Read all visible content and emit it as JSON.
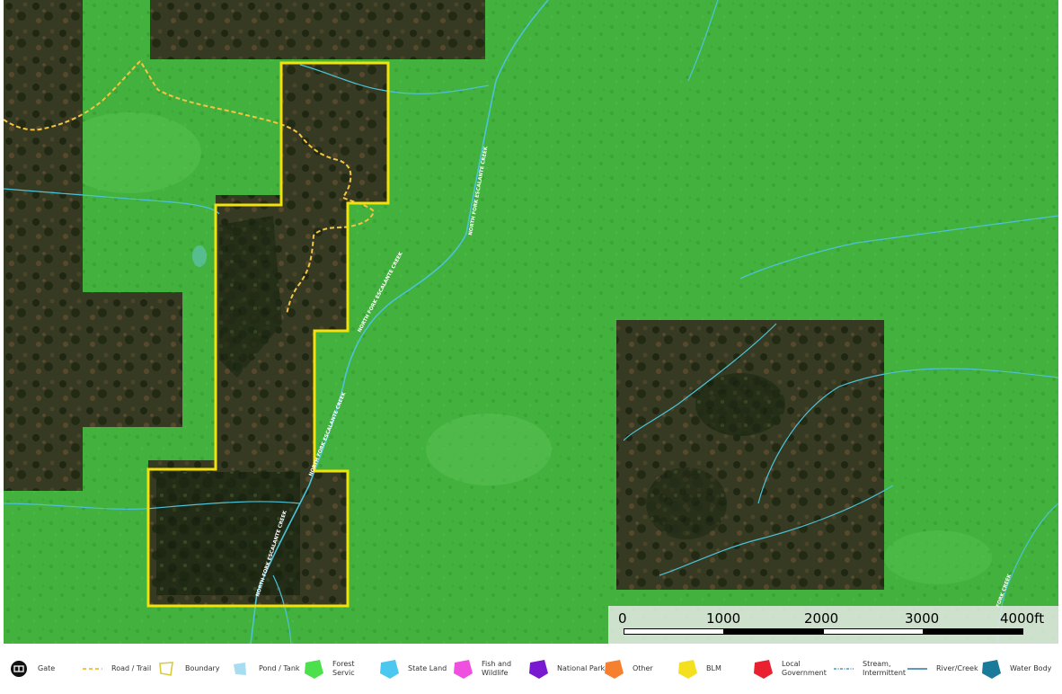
{
  "map": {
    "creek_labels": [
      "NORTH FORK ESCALANTE CREEK",
      "NORTH FORK ESCALANTE CREEK",
      "NORTH FORK ESCALANTE CREEK",
      "NORTH FORK ESCALANTE CREEK"
    ],
    "edge_label": "FORK CREEK",
    "colors": {
      "forest": "#3fae3a",
      "private": "#2e331f",
      "boundary": "#f2e10a",
      "trail": "#f5c542",
      "stream": "#4cc3d9"
    }
  },
  "scale": {
    "ticks": [
      "0",
      "1000",
      "2000",
      "3000",
      "4000ft"
    ]
  },
  "legend": [
    {
      "label": "Gate",
      "icon": "gate-icon",
      "color": "#000000"
    },
    {
      "label": "Road / Trail",
      "icon": "road-trail-icon",
      "color": "#f5c542"
    },
    {
      "label": "Boundary",
      "icon": "boundary-icon",
      "color": "#d8cc3a"
    },
    {
      "label": "Pond / Tank",
      "icon": "pond-tank-icon",
      "color": "#a8dcf0"
    },
    {
      "label": "Forest Servic",
      "icon": "forest-service-icon",
      "color": "#4ce04c"
    },
    {
      "label": "State Land",
      "icon": "state-land-icon",
      "color": "#4cc8f0"
    },
    {
      "label": "Fish and\nWildlife",
      "icon": "fish-wildlife-icon",
      "color": "#f050e0"
    },
    {
      "label": "National Park",
      "icon": "national-park-icon",
      "color": "#7a1ad0"
    },
    {
      "label": "Other",
      "icon": "other-icon",
      "color": "#f58030"
    },
    {
      "label": "BLM",
      "icon": "blm-icon",
      "color": "#f5e020"
    },
    {
      "label": "Local\nGovernment",
      "icon": "local-government-icon",
      "color": "#e82030"
    },
    {
      "label": "Stream,\nIntermittent",
      "icon": "stream-intermittent-icon",
      "color": "#4a9ab8"
    },
    {
      "label": "River/Creek",
      "icon": "river-creek-icon",
      "color": "#2a7aa8"
    },
    {
      "label": "Water Body",
      "icon": "water-body-icon",
      "color": "#1a7a9a"
    }
  ]
}
